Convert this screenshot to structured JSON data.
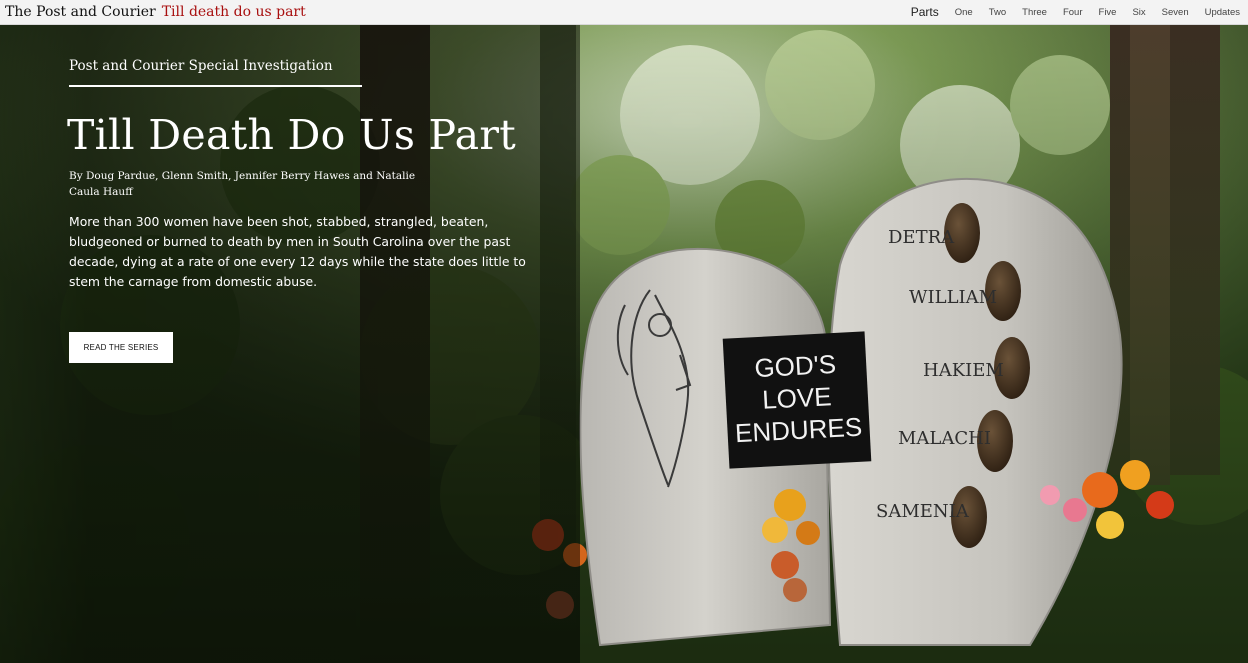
{
  "header": {
    "brand": "The Post and Courier",
    "series": "Till death do us part",
    "nav_label": "Parts",
    "nav_items": [
      "One",
      "Two",
      "Three",
      "Four",
      "Five",
      "Six",
      "Seven",
      "Updates"
    ]
  },
  "hero": {
    "kicker": "Post and Courier Special Investigation",
    "headline": "Till Death Do Us Part",
    "byline": "By Doug Pardue, Glenn Smith, Jennifer Berry Hawes and Natalie Caula Hauff",
    "dek": "More than 300 women have been shot, stabbed, strangled, beaten, bludgeoned or burned to death by men in South Carolina over the past decade, dying at a rate of one every 12 days while the state does little to stem the carnage from domestic abuse.",
    "cta_label": "READ THE SERIES"
  },
  "memorial": {
    "plaque_lines": [
      "GOD'S",
      "LOVE",
      "ENDURES"
    ],
    "names": [
      "DETRA",
      "WILLIAM",
      "HAKIEM",
      "MALACHI",
      "SAMENIA"
    ]
  },
  "colors": {
    "accent_red": "#a80f0f",
    "topbar_bg": "#f3f3f3"
  }
}
